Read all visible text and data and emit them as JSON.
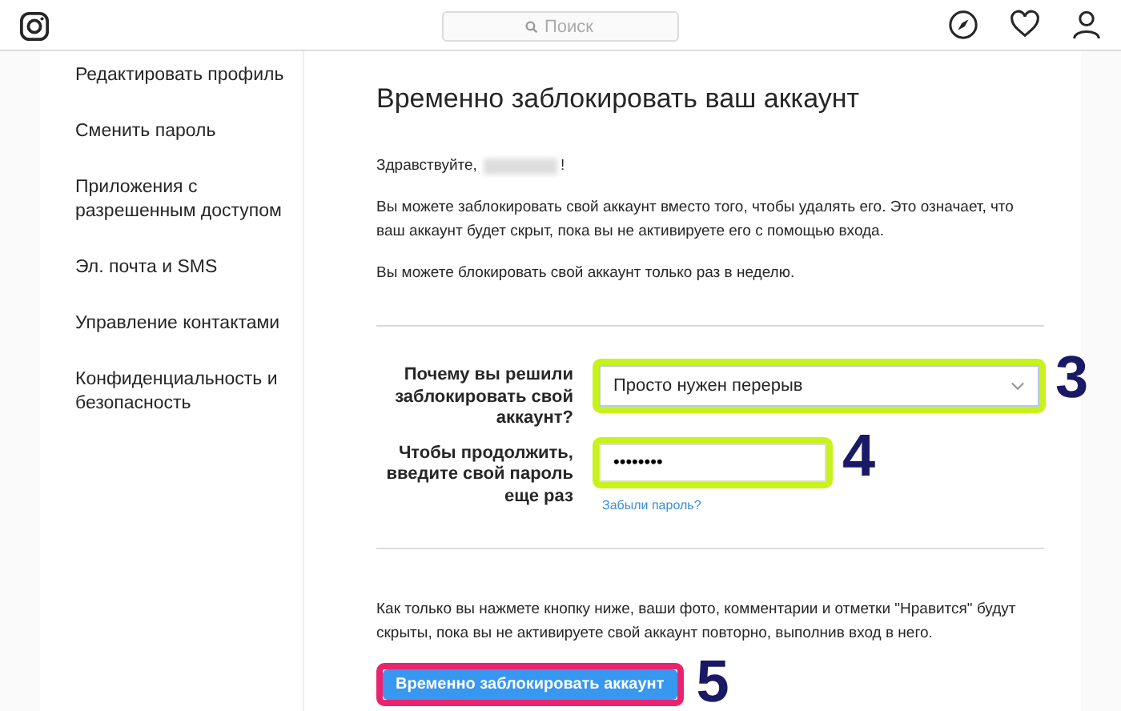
{
  "nav": {
    "search_placeholder": "Поиск"
  },
  "sidebar": {
    "items": [
      {
        "label": "Редактировать профиль"
      },
      {
        "label": "Сменить пароль"
      },
      {
        "label": "Приложения с разрешенным доступом"
      },
      {
        "label": "Эл. почта и SMS"
      },
      {
        "label": "Управление контактами"
      },
      {
        "label": "Конфиденциальность и безопасность"
      }
    ]
  },
  "page": {
    "title": "Временно заблокировать ваш аккаунт",
    "greeting": "Здравствуйте,",
    "greeting_end": "!",
    "paragraphs": [
      "Вы можете заблокировать свой аккаунт вместо того, чтобы удалять его. Это означает, что ваш аккаунт будет скрыт, пока вы не активируете его с помощью входа.",
      "Вы можете блокировать свой аккаунт только раз в неделю."
    ],
    "form": [
      {
        "kind": "select",
        "label": "Почему вы решили заблокировать свой аккаунт?",
        "value": "Просто нужен перерыв",
        "callout": "3"
      },
      {
        "kind": "password",
        "label": "Чтобы продолжить, введите свой пароль еще раз",
        "value": "••••••••",
        "callout": "4",
        "link": "Забыли пароль?"
      }
    ],
    "notice": "Как только вы нажмете кнопку ниже, ваши фото, комментарии и отметки \"Нравится\" будут скрыты, пока вы не активируете свой аккаунт повторно, выполнив вход в него.",
    "button": {
      "label": "Временно заблокировать аккаунт",
      "callout": "5"
    }
  }
}
